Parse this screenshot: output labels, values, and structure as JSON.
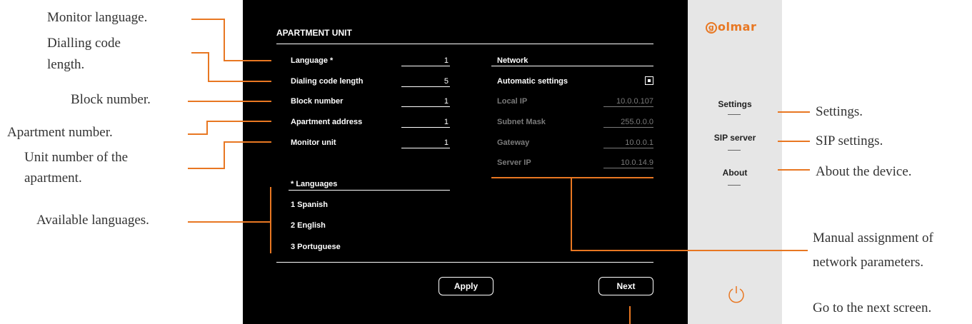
{
  "annotations": {
    "monitor_language": "Monitor language.",
    "dialling_code_1": "Dialling code",
    "dialling_code_2": "length.",
    "block_number": "Block number.",
    "apartment_number": "Apartment number.",
    "unit_number_1": "Unit number of the",
    "unit_number_2": "apartment.",
    "available_languages": "Available languages.",
    "settings": "Settings.",
    "sip_settings": "SIP settings.",
    "about_device": "About the device.",
    "manual_assignment_1": "Manual assignment of",
    "manual_assignment_2": "network parameters.",
    "next_screen": "Go to the next screen."
  },
  "screen": {
    "title": "APARTMENT UNIT",
    "fields": [
      {
        "label": "Language *",
        "value": "1"
      },
      {
        "label": "Dialing code length",
        "value": "5"
      },
      {
        "label": "Block number",
        "value": "1"
      },
      {
        "label": "Apartment address",
        "value": "1"
      },
      {
        "label": "Monitor unit",
        "value": "1"
      }
    ],
    "network": {
      "heading": "Network",
      "automatic_label": "Automatic settings",
      "automatic_checked": true,
      "fields": [
        {
          "label": "Local IP",
          "value": "10.0.0.107"
        },
        {
          "label": "Subnet Mask",
          "value": "255.0.0.0"
        },
        {
          "label": "Gateway",
          "value": "10.0.0.1"
        },
        {
          "label": "Server IP",
          "value": "10.0.14.9"
        }
      ]
    },
    "languages": {
      "heading": "* Languages",
      "items": [
        "1 Spanish",
        "2 English",
        "3 Portuguese"
      ]
    },
    "buttons": {
      "apply": "Apply",
      "next": "Next"
    }
  },
  "sidebar": {
    "logo": "olmar",
    "logo_initial": "g",
    "menu": [
      "Settings",
      "SIP server",
      "About"
    ],
    "power_icon": "power-icon"
  },
  "colors": {
    "accent": "#e87722",
    "screen_bg": "#000000",
    "panel_bg": "#e6e6e6",
    "disabled_text": "#7a7a7a"
  }
}
